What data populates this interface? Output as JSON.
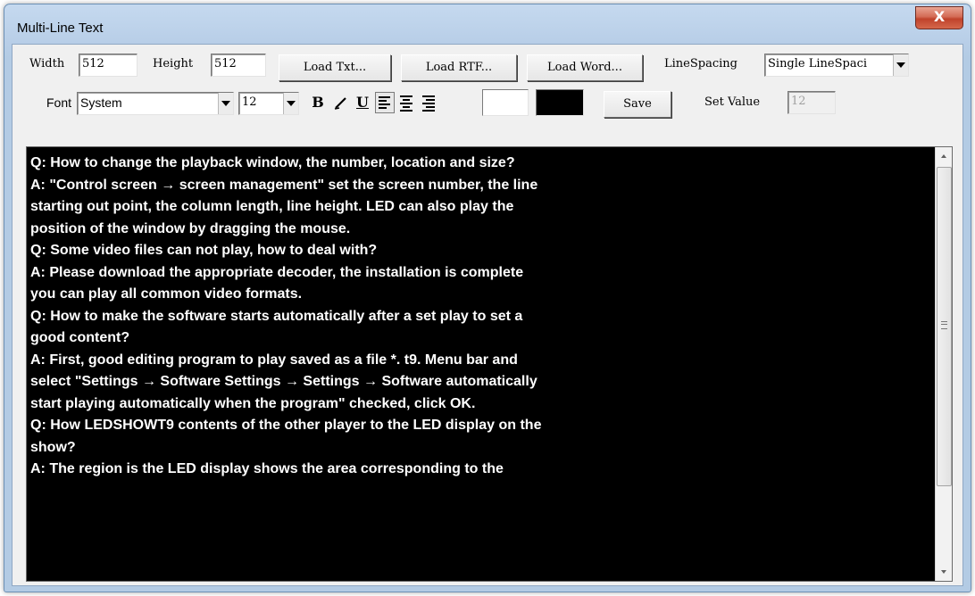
{
  "window": {
    "title": "Multi-Line Text",
    "close_label": "X"
  },
  "toolbar": {
    "width_label": "Width",
    "width_value": "512",
    "height_label": "Height",
    "height_value": "512",
    "load_txt": "Load Txt...",
    "load_rtf": "Load RTF...",
    "load_word": "Load Word...",
    "linespacing_label": "LineSpacing",
    "linespacing_value": "Single LineSpaci",
    "font_label": "Font",
    "font_value": "System",
    "size_value": "12",
    "bold": "B",
    "italic": "I",
    "underline": "U",
    "save": "Save",
    "set_value_label": "Set Value",
    "set_value": "12",
    "text_color": "#ffffff",
    "background_color": "#000000"
  },
  "editor": {
    "lines": [
      "Q: How to change the playback window, the number, location and size?",
      "A: \"Control screen → screen management\" set the screen number, the line",
      "starting out point, the column length, line height. LED can also play the",
      "position of the window by dragging the mouse.",
      "Q: Some video files can not play, how to deal with?",
      "A: Please download the appropriate decoder, the installation is complete",
      "you can play all common video formats.",
      "Q: How to make the software starts automatically after a set play to set a",
      "good content?",
      "A: First, good editing program to play saved as a file *. t9. Menu bar and",
      "select \"Settings → Software Settings → Settings → Software automatically",
      "start playing automatically when the program\" checked, click OK.",
      "Q: How LEDSHOWT9 contents of the other player to the LED display on the",
      "show?",
      "A: The region is the LED display shows the area corresponding to the"
    ]
  }
}
